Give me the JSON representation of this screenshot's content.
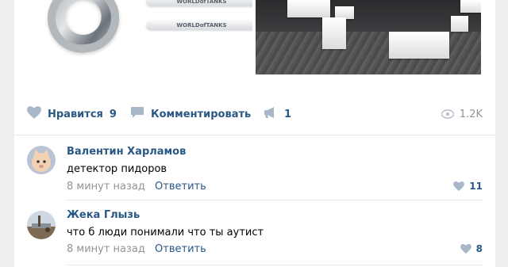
{
  "post": {
    "media": {
      "tag_text": "WORLDofTANKS"
    },
    "actions": {
      "like_label": "Нравится",
      "like_count": "9",
      "comment_label": "Комментировать",
      "share_count": "1",
      "views_count": "1.2K"
    }
  },
  "comments": [
    {
      "author": "Валентин Харламов",
      "text": "детектор пидоров",
      "time": "8 минут назад",
      "reply_label": "Ответить",
      "likes": "11"
    },
    {
      "author": "Жека Глызь",
      "text": "что б люди понимали что ты аутист",
      "time": "8 минут назад",
      "reply_label": "Ответить",
      "likes": "8"
    }
  ],
  "colors": {
    "link": "#2a5885",
    "muted": "#939393",
    "icon": "#a9b8c9",
    "background": "#edeef0"
  },
  "icons": {
    "like": "heart-icon",
    "comment": "comment-icon",
    "share": "megaphone-icon",
    "views": "eye-icon"
  }
}
